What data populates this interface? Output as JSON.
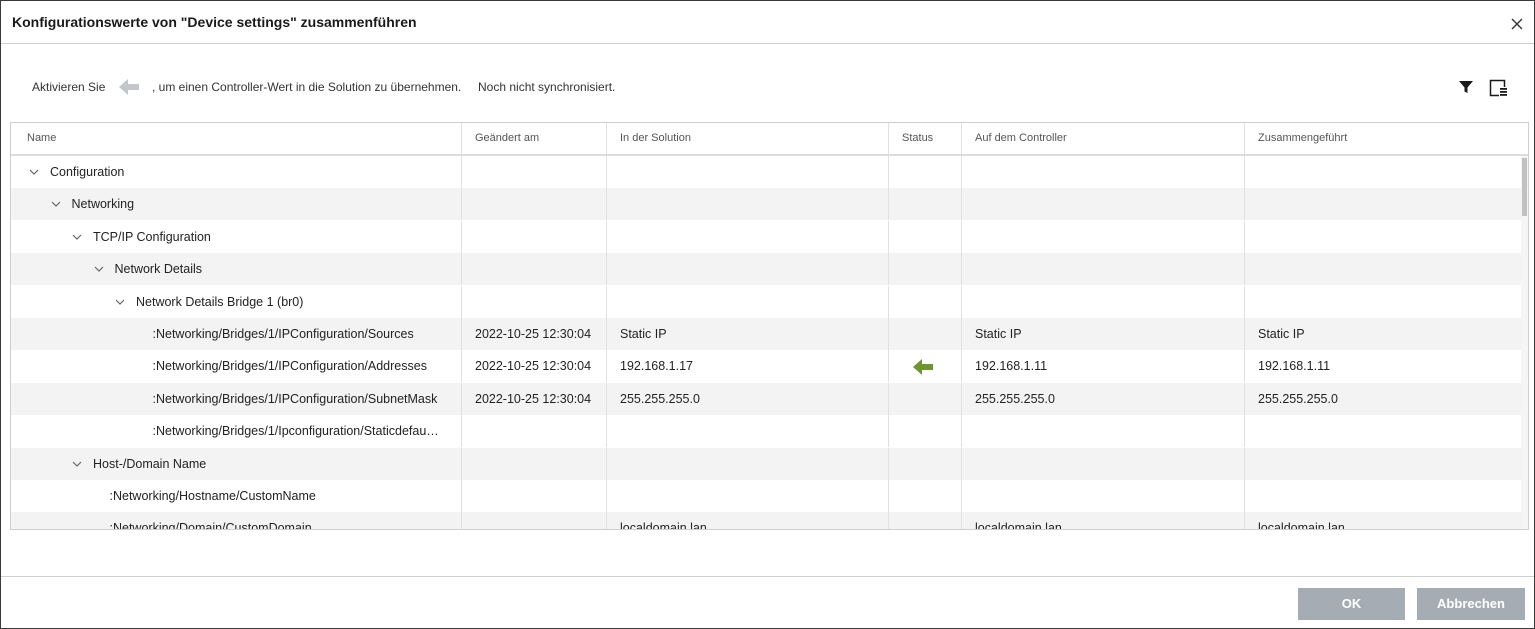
{
  "dialog": {
    "title": "Konfigurationswerte von \"Device settings\" zusammenführen",
    "hint_before": "Aktivieren Sie",
    "hint_after": ", um einen Controller-Wert in die Solution zu übernehmen.",
    "sync_status": "Noch nicht synchronisiert.",
    "icons": {
      "close": "close-icon",
      "hint_arrow": "arrow-left-icon",
      "filter": "filter-icon",
      "columns": "column-chooser-icon"
    }
  },
  "colors": {
    "accent_arrow": "#6e9434",
    "button_bg": "#a5acb4",
    "row_alt": "#f3f3f3"
  },
  "columns": [
    "Name",
    "Geändert am",
    "In der Solution",
    "Status",
    "Auf dem Controller",
    "Zusammengeführt"
  ],
  "rows": [
    {
      "name": "Configuration",
      "level": 0,
      "expanded": true,
      "changed": "",
      "solution": "",
      "status": "",
      "controller": "",
      "merged": ""
    },
    {
      "name": "Networking",
      "level": 1,
      "expanded": true,
      "changed": "",
      "solution": "",
      "status": "",
      "controller": "",
      "merged": ""
    },
    {
      "name": "TCP/IP Configuration",
      "level": 2,
      "expanded": true,
      "changed": "",
      "solution": "",
      "status": "",
      "controller": "",
      "merged": ""
    },
    {
      "name": "Network Details",
      "level": 3,
      "expanded": true,
      "changed": "",
      "solution": "",
      "status": "",
      "controller": "",
      "merged": ""
    },
    {
      "name": "Network Details Bridge 1 (br0)",
      "level": 4,
      "expanded": true,
      "changed": "",
      "solution": "",
      "status": "",
      "controller": "",
      "merged": ""
    },
    {
      "name": ":Networking/Bridges/1/IPConfiguration/Sources",
      "level": 5,
      "leaf": true,
      "changed": "2022-10-25 12:30:04",
      "solution": "Static IP",
      "status": "",
      "controller": "Static IP",
      "merged": "Static IP"
    },
    {
      "name": ":Networking/Bridges/1/IPConfiguration/Addresses",
      "level": 5,
      "leaf": true,
      "changed": "2022-10-25 12:30:04",
      "solution": "192.168.1.17",
      "status": "arrow-left-icon",
      "controller": "192.168.1.11",
      "merged": "192.168.1.11"
    },
    {
      "name": ":Networking/Bridges/1/IPConfiguration/SubnetMask",
      "level": 5,
      "leaf": true,
      "changed": "2022-10-25 12:30:04",
      "solution": "255.255.255.0",
      "status": "",
      "controller": "255.255.255.0",
      "merged": "255.255.255.0"
    },
    {
      "name": ":Networking/Bridges/1/Ipconfiguration/Staticdefau…",
      "level": 5,
      "leaf": true,
      "changed": "",
      "solution": "",
      "status": "",
      "controller": "",
      "merged": ""
    },
    {
      "name": "Host-/Domain Name",
      "level": 2,
      "expanded": true,
      "changed": "",
      "solution": "",
      "status": "",
      "controller": "",
      "merged": ""
    },
    {
      "name": ":Networking/Hostname/CustomName",
      "level": 3,
      "leaf": true,
      "changed": "",
      "solution": "",
      "status": "",
      "controller": "",
      "merged": ""
    },
    {
      "name": ":Networking/Domain/CustomDomain",
      "level": 3,
      "leaf": true,
      "changed": "",
      "solution": "localdomain.lan",
      "status": "",
      "controller": "localdomain.lan",
      "merged": "localdomain.lan"
    }
  ],
  "buttons": {
    "ok": "OK",
    "cancel": "Abbrechen"
  }
}
